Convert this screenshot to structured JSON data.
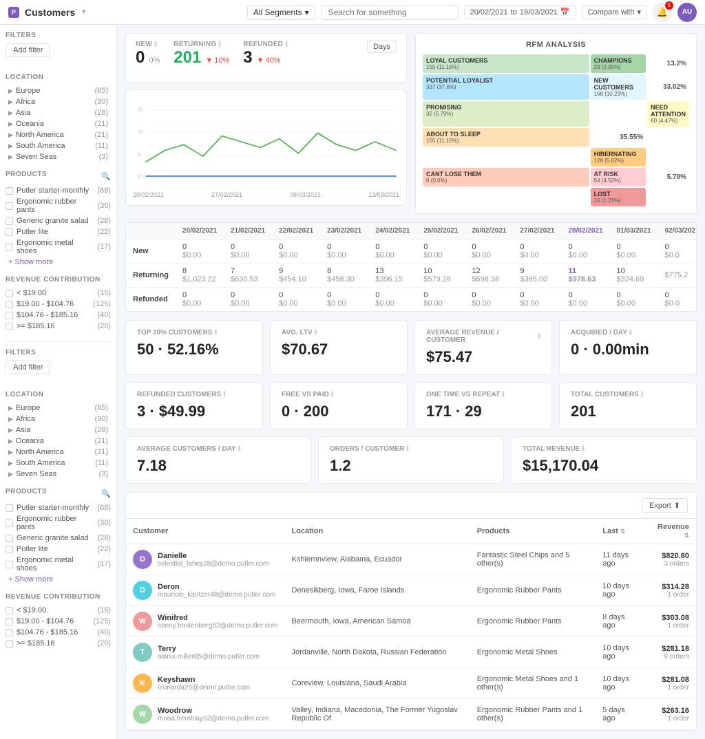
{
  "header": {
    "logo_text": "P",
    "title": "Customers",
    "segment_label": "All Segments",
    "search_placeholder": "Search for something",
    "date_from": "20/02/2021",
    "date_to": "19/03/2021",
    "compare_label": "Compare with",
    "notif_count": "5",
    "avatar_initials": "AU"
  },
  "sidebar1": {
    "filters_label": "FILTERS",
    "add_filter_label": "Add filter",
    "location_label": "LOCATION",
    "locations": [
      {
        "name": "Europe",
        "count": "(85)"
      },
      {
        "name": "Africa",
        "count": "(30)"
      },
      {
        "name": "Asia",
        "count": "(28)"
      },
      {
        "name": "Oceania",
        "count": "(21)"
      },
      {
        "name": "North America",
        "count": "(21)"
      },
      {
        "name": "South America",
        "count": "(11)"
      },
      {
        "name": "Seven Seas",
        "count": "(3)"
      }
    ],
    "products_label": "PRODUCTS",
    "products": [
      {
        "name": "Putler starter-monthly",
        "count": "(68)"
      },
      {
        "name": "Ergonomic rubber pants",
        "count": "(30)"
      },
      {
        "name": "Generic granite salad",
        "count": "(28)"
      },
      {
        "name": "Putler lite",
        "count": "(22)"
      },
      {
        "name": "Ergonomic metal shoes",
        "count": "(17)"
      }
    ],
    "show_more_label": "+ Show more",
    "revenue_label": "REVENUE CONTRIBUTION",
    "revenues": [
      {
        "range": "< $19.00",
        "count": "(15)"
      },
      {
        "range": "$19.00 - $104.76",
        "count": "(125)"
      },
      {
        "range": "$104.76 - $185.16",
        "count": "(40)"
      },
      {
        "range": ">= $185.16",
        "count": "(20)"
      }
    ]
  },
  "sidebar2": {
    "filters_label": "FILTERS",
    "add_filter_label": "Add filter",
    "location_label": "LOCATION",
    "locations": [
      {
        "name": "Europe",
        "count": "(85)"
      },
      {
        "name": "Africa",
        "count": "(30)"
      },
      {
        "name": "Asia",
        "count": "(28)"
      },
      {
        "name": "Oceania",
        "count": "(21)"
      },
      {
        "name": "North America",
        "count": "(21)"
      },
      {
        "name": "South America",
        "count": "(11)"
      },
      {
        "name": "Seven Seas",
        "count": "(3)"
      }
    ],
    "products_label": "PRODUCTS",
    "products": [
      {
        "name": "Putler starter-monthly",
        "count": "(68)"
      },
      {
        "name": "Ergonomic rubber pants",
        "count": "(30)"
      },
      {
        "name": "Generic granite salad",
        "count": "(28)"
      },
      {
        "name": "Putler lite",
        "count": "(22)"
      },
      {
        "name": "Ergonomic metal shoes",
        "count": "(17)"
      }
    ],
    "show_more_label": "+ Show more",
    "revenue_label": "REVENUE CONTRIBUTION",
    "revenues": [
      {
        "range": "< $19.00",
        "count": "(15)"
      },
      {
        "range": "$19.00 - $104.76",
        "count": "(125)"
      },
      {
        "range": "$104.76 - $185.16",
        "count": "(40)"
      },
      {
        "range": ">= $185.16",
        "count": "(20)"
      }
    ]
  },
  "stats": {
    "new_label": "NEW",
    "new_value": "0",
    "new_pct": "0%",
    "returning_label": "RETURNING",
    "returning_value": "201",
    "returning_change": "10%",
    "returning_dir": "down",
    "refunded_label": "REFUNDED",
    "refunded_value": "3",
    "refunded_change": "40%",
    "refunded_dir": "down",
    "days_label": "Days"
  },
  "rfm": {
    "title": "RFM ANALYSIS",
    "cells": [
      {
        "label": "LOYAL CUSTOMERS",
        "count": "155 (11.15%)",
        "color": "#c8e6c9",
        "pct": ""
      },
      {
        "label": "CHAMPIONS",
        "count": "29 (2.05%)",
        "color": "#a5d6a7",
        "pct": "13.2%"
      },
      {
        "label": "POTENTIAL LOYALIST",
        "count": "337 (37.6%)",
        "color": "#b3e5fc",
        "pct": ""
      },
      {
        "label": "NEW CUSTOMERS",
        "count": "168 (10.23%)",
        "color": "#e1f5fe",
        "pct": "33.02%"
      },
      {
        "label": "PROMISING",
        "count": "32 (5.79%)",
        "color": "#e8f5e9",
        "pct": ""
      },
      {
        "label": "NEED ATTENTION",
        "count": "60 (4.47%)",
        "color": "#fff9c4",
        "pct": ""
      },
      {
        "label": "ABOUT TO SLEEP",
        "count": "155 (11.15%)",
        "color": "#fff9c4",
        "pct": "35.55%"
      },
      {
        "label": "HIBERNATING",
        "count": "128 (5.62%)",
        "color": "#ffe0b2",
        "pct": ""
      },
      {
        "label": "CANT LOSE THEM",
        "count": "0 (0.0%)",
        "color": "#ffccbc",
        "pct": ""
      },
      {
        "label": "AT RISK",
        "count": "54 (4.52%)",
        "color": "#ffcdd2",
        "pct": "5.78%"
      },
      {
        "label": "LOST",
        "count": "16 (1.21%)",
        "color": "#ef9a9a",
        "pct": ""
      }
    ]
  },
  "date_table": {
    "dates": [
      "20/02/2021",
      "21/02/2021",
      "22/02/2021",
      "23/02/2021",
      "24/02/2021",
      "25/02/2021",
      "26/02/2021",
      "27/02/2021",
      "28/02/2021",
      "01/03/2021",
      "02/03/20"
    ],
    "rows": [
      {
        "label": "New",
        "values": [
          {
            "count": "0",
            "revenue": "$0.00"
          },
          {
            "count": "0",
            "revenue": "$0.00"
          },
          {
            "count": "0",
            "revenue": "$0.00"
          },
          {
            "count": "0",
            "revenue": "$0.00"
          },
          {
            "count": "0",
            "revenue": "$0.00"
          },
          {
            "count": "0",
            "revenue": "$0.00"
          },
          {
            "count": "0",
            "revenue": "$0.00"
          },
          {
            "count": "0",
            "revenue": "$0.00"
          },
          {
            "count": "0",
            "revenue": "$0.00"
          },
          {
            "count": "0",
            "revenue": "$0.00"
          },
          {
            "count": "0",
            "revenue": "$0.0"
          }
        ]
      },
      {
        "label": "Returning",
        "values": [
          {
            "count": "8",
            "revenue": "$1,023.22"
          },
          {
            "count": "7",
            "revenue": "$630.53"
          },
          {
            "count": "9",
            "revenue": "$454.10"
          },
          {
            "count": "8",
            "revenue": "$458.30"
          },
          {
            "count": "13",
            "revenue": "$396.15"
          },
          {
            "count": "10",
            "revenue": "$579.26"
          },
          {
            "count": "12",
            "revenue": "$698.36"
          },
          {
            "count": "9",
            "revenue": "$385.00"
          },
          {
            "count": "11",
            "revenue": "$978.63"
          },
          {
            "count": "10",
            "revenue": "$324.69"
          },
          {
            "count": "",
            "revenue": "$775.2"
          }
        ]
      },
      {
        "label": "Refunded",
        "values": [
          {
            "count": "0",
            "revenue": "$0.00"
          },
          {
            "count": "0",
            "revenue": "$0.00"
          },
          {
            "count": "0",
            "revenue": "$0.00"
          },
          {
            "count": "0",
            "revenue": "$0.00"
          },
          {
            "count": "0",
            "revenue": "$0.00"
          },
          {
            "count": "0",
            "revenue": "$0.00"
          },
          {
            "count": "0",
            "revenue": "$0.00"
          },
          {
            "count": "0",
            "revenue": "$0.00"
          },
          {
            "count": "0",
            "revenue": "$0.00"
          },
          {
            "count": "0",
            "revenue": "$0.00"
          },
          {
            "count": "0",
            "revenue": "$0.0"
          }
        ]
      }
    ]
  },
  "metrics": [
    {
      "label": "TOP 20% CUSTOMERS",
      "value": "50 · 52.16%"
    },
    {
      "label": "AVG. LTV",
      "value": "$70.67"
    },
    {
      "label": "AVERAGE REVENUE / CUSTOMER",
      "value": "$75.47"
    },
    {
      "label": "ACQUIRED / DAY",
      "value": "0 · 0.00min"
    }
  ],
  "metrics2": [
    {
      "label": "REFUNDED CUSTOMERS",
      "value": "3 · $49.99"
    },
    {
      "label": "FREE VS PAID",
      "value": "0 · 200"
    },
    {
      "label": "ONE TIME VS REPEAT",
      "value": "171 · 29"
    },
    {
      "label": "TOTAL CUSTOMERS",
      "value": "201"
    }
  ],
  "metrics3": [
    {
      "label": "AVERAGE CUSTOMERS / DAY",
      "value": "7.18"
    },
    {
      "label": "ORDERS / CUSTOMER",
      "value": "1.2"
    },
    {
      "label": "TOTAL REVENUE",
      "value": "$15,170.04"
    }
  ],
  "customer_table": {
    "export_label": "Export",
    "columns": [
      "Customer",
      "Location",
      "Products",
      "Last",
      "Revenue"
    ],
    "rows": [
      {
        "name": "Danielle",
        "email": "celestial_fahey28@demo.putler.com",
        "location": "Kshlernnview, Alabama, Ecuador",
        "products": "Fantastic Steel Chips and 5 other(s)",
        "last": "11 days ago",
        "revenue": "$820.80",
        "orders": "3 orders",
        "color": "#9575cd",
        "initials": "D"
      },
      {
        "name": "Deron",
        "email": "mauricio_kautzer48@demo.putler.com",
        "location": "Denesikberg, Iowa, Faroe Islands",
        "products": "Ergonomic Rubber Pants",
        "last": "10 days ago",
        "revenue": "$314.28",
        "orders": "1 order",
        "color": "#4dd0e1",
        "initials": "D"
      },
      {
        "name": "Winifred",
        "email": "sonny.breitenberg52@demo.putler.com",
        "location": "Beermouth, Iowa, American Samoa",
        "products": "Ergonomic Rubber Pants",
        "last": "8 days ago",
        "revenue": "$303.08",
        "orders": "1 order",
        "color": "#ef9a9a",
        "initials": "W"
      },
      {
        "name": "Terry",
        "email": "alanix.miller85@demo.putler.com",
        "location": "Jordanville, North Dakota, Russian Federation",
        "products": "Ergonomic Metal Shoes",
        "last": "10 days ago",
        "revenue": "$281.18",
        "orders": "9 orders",
        "color": "#80cbc4",
        "initials": "T"
      },
      {
        "name": "Keyshawn",
        "email": "leonarda25@demo.putler.com",
        "location": "Coreview, Louisiana, Saudi Arabia",
        "products": "Ergonomic Metal Shoes and 1 other(s)",
        "last": "10 days ago",
        "revenue": "$281.08",
        "orders": "1 order",
        "color": "#ffb74d",
        "initials": "K"
      },
      {
        "name": "Woodrow",
        "email": "mona.tremblay52@demo.putler.com",
        "location": "Valley, Indiana, Macedonia, The Former Yugoslav Republic Of",
        "products": "Ergonomic Rubber Pants and 1 other(s)",
        "last": "5 days ago",
        "revenue": "$263.16",
        "orders": "1 order",
        "color": "#a5d6a7",
        "initials": "W"
      }
    ]
  }
}
